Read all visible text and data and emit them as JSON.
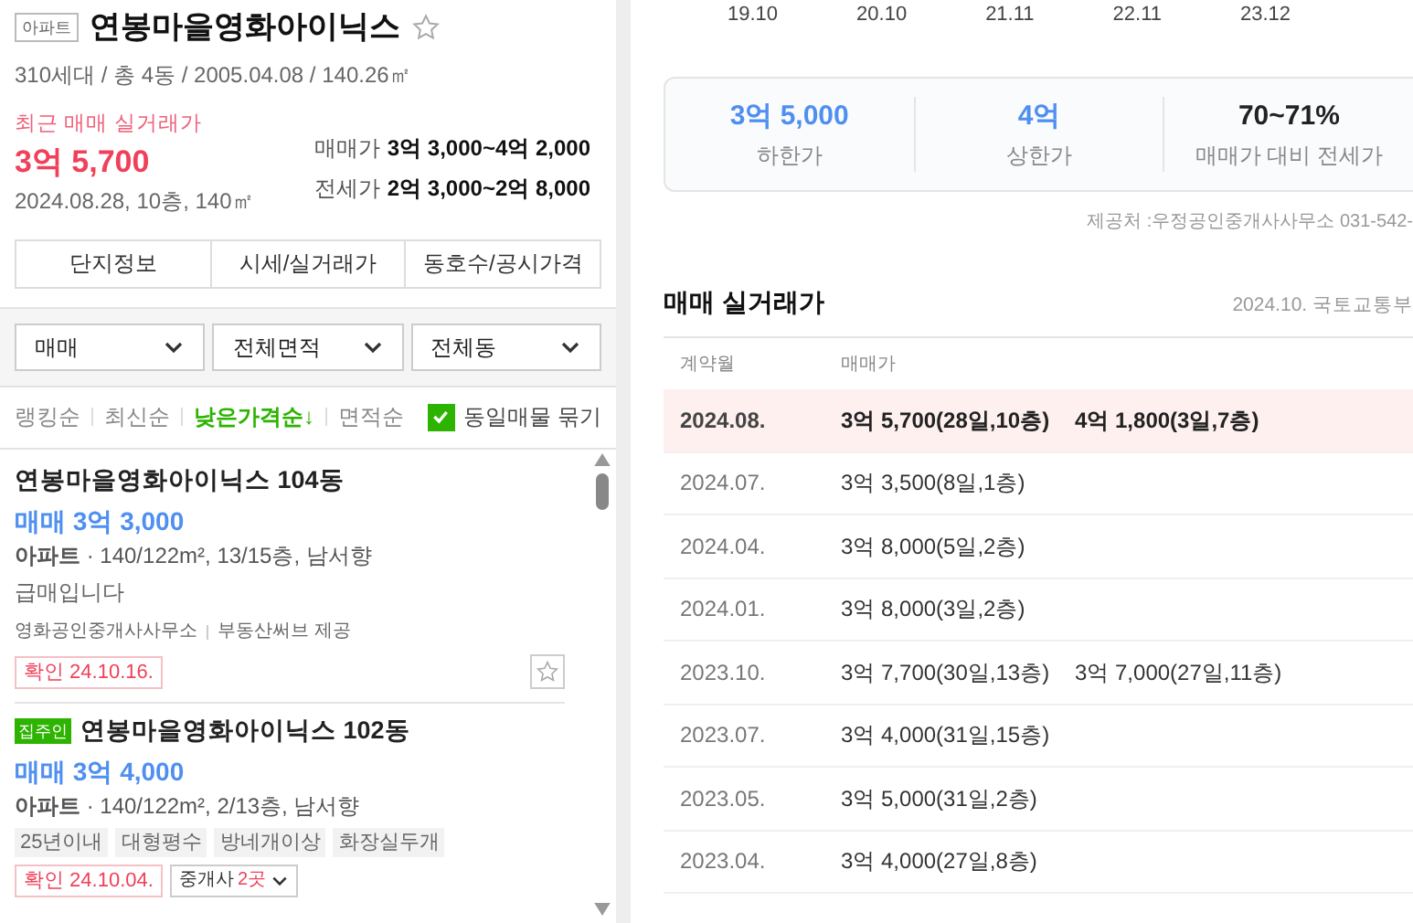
{
  "complex": {
    "type_badge": "아파트",
    "name": "연봉마을영화아이닉스",
    "favorite": false,
    "info": "310세대 / 총 4동 / 2005.04.08 / 140.26㎡",
    "recent_label": "최근 매매 실거래가",
    "recent_price": "3억 5,700",
    "recent_detail": "2024.08.28, 10층, 140㎡",
    "price_ranges": [
      {
        "label": "매매가",
        "value": "3억 3,000~4억 2,000"
      },
      {
        "label": "전세가",
        "value": "2억 3,000~2억 8,000"
      }
    ]
  },
  "tabs": [
    {
      "label": "단지정보",
      "selected": false
    },
    {
      "label": "시세/실거래가",
      "selected": false
    },
    {
      "label": "동호수/공시가격",
      "selected": false
    }
  ],
  "filters": [
    {
      "value": "매매"
    },
    {
      "value": "전체면적"
    },
    {
      "value": "전체동"
    }
  ],
  "sort_options": [
    {
      "label": "랭킹순",
      "selected": false
    },
    {
      "label": "최신순",
      "selected": false
    },
    {
      "label": "낮은가격순",
      "arrow": "↓",
      "selected": true
    },
    {
      "label": "면적순",
      "selected": false
    }
  ],
  "group_same": {
    "label": "동일매물 묶기",
    "checked": true
  },
  "listings": [
    {
      "title": "연봉마을영화아이닉스 104동",
      "price": "매매 3억 3,000",
      "detail": "**아파트** · 140/122m², 13/15층, 남서향",
      "description": "급매입니다",
      "agency": "영화공인중개사사무소",
      "provider": "부동산써브 제공",
      "confirmed": "확인 24.10.16.",
      "favorite": false
    },
    {
      "owner_badge": "집주인",
      "title": "연봉마을영화아이닉스 102동",
      "price": "매매 3억 4,000",
      "detail": "**아파트** · 140/122m², 2/13층, 남서향",
      "tags": [
        "25년이내",
        "대형평수",
        "방네개이상",
        "화장실두개"
      ],
      "confirmed": "확인 24.10.04.",
      "agents": {
        "label": "중개사",
        "count": "2곳"
      }
    }
  ],
  "chart_axis_labels": [
    "19.10",
    "20.10",
    "21.11",
    "22.11",
    "23.12"
  ],
  "summary": [
    {
      "value": "3억 5,000",
      "label": "하한가",
      "kind": "blue"
    },
    {
      "value": "4억",
      "label": "상한가",
      "kind": "blue"
    },
    {
      "value": "70~71%",
      "label": "매매가 대비 전세가",
      "kind": "dark"
    }
  ],
  "source": "제공처 :우정공인중개사사무소 031-542-",
  "transactions": {
    "title": "매매 실거래가",
    "source": "2024.10. 국토교통부",
    "columns": [
      "계약월",
      "매매가"
    ],
    "rows": [
      {
        "month": "2024.08.",
        "deals": [
          "3억 5,700(28일,10층)",
          "4억 1,800(3일,7층)"
        ],
        "highlighted": true
      },
      {
        "month": "2024.07.",
        "deals": [
          "3억 3,500(8일,1층)"
        ],
        "highlighted": false
      },
      {
        "month": "2024.04.",
        "deals": [
          "3억 8,000(5일,2층)"
        ],
        "highlighted": false
      },
      {
        "month": "2024.01.",
        "deals": [
          "3억 8,000(3일,2층)"
        ],
        "highlighted": false
      },
      {
        "month": "2023.10.",
        "deals": [
          "3억 7,700(30일,13층)",
          "3억 7,000(27일,11층)"
        ],
        "highlighted": false
      },
      {
        "month": "2023.07.",
        "deals": [
          "3억 4,000(31일,15층)"
        ],
        "highlighted": false
      },
      {
        "month": "2023.05.",
        "deals": [
          "3억 5,000(31일,2층)"
        ],
        "highlighted": false
      },
      {
        "month": "2023.04.",
        "deals": [
          "3억 4,000(27일,8층)"
        ],
        "highlighted": false
      }
    ]
  }
}
